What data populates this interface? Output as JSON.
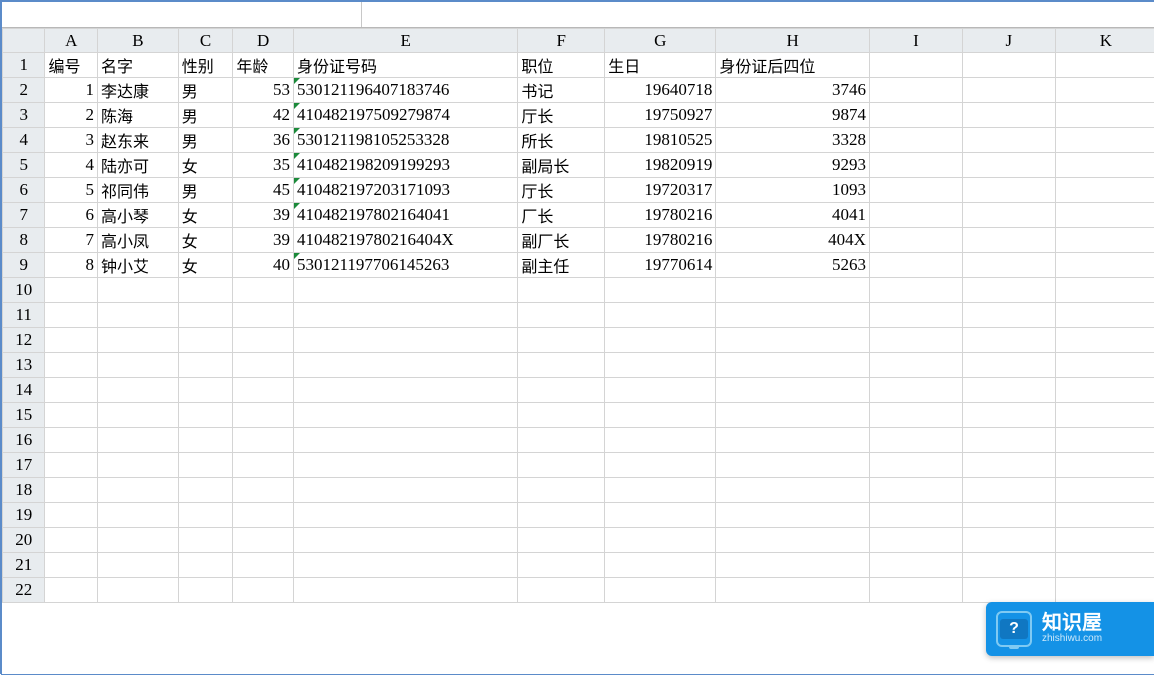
{
  "columns": [
    "A",
    "B",
    "C",
    "D",
    "E",
    "F",
    "G",
    "H",
    "I",
    "J",
    "K"
  ],
  "colClasses": [
    "cA",
    "cB",
    "cC",
    "cD",
    "cE",
    "cF",
    "cG",
    "cH",
    "cI",
    "cJ",
    "cK"
  ],
  "header_row": {
    "A": "编号",
    "B": "名字",
    "C": "性别",
    "D": "年龄",
    "E": "身份证号码",
    "F": "职位",
    "G": "生日",
    "H": "身份证后四位"
  },
  "rows": [
    {
      "no": "1",
      "name": "李达康",
      "sex": "男",
      "age": "53",
      "id": "530121196407183746",
      "title": "书记",
      "bday": "19640718",
      "last4": "3746"
    },
    {
      "no": "2",
      "name": "陈海",
      "sex": "男",
      "age": "42",
      "id": "410482197509279874",
      "title": "厅长",
      "bday": "19750927",
      "last4": "9874"
    },
    {
      "no": "3",
      "name": "赵东来",
      "sex": "男",
      "age": "36",
      "id": "530121198105253328",
      "title": "所长",
      "bday": "19810525",
      "last4": "3328"
    },
    {
      "no": "4",
      "name": "陆亦可",
      "sex": "女",
      "age": "35",
      "id": "410482198209199293",
      "title": "副局长",
      "bday": "19820919",
      "last4": "9293"
    },
    {
      "no": "5",
      "name": "祁同伟",
      "sex": "男",
      "age": "45",
      "id": "410482197203171093",
      "title": "厅长",
      "bday": "19720317",
      "last4": "1093"
    },
    {
      "no": "6",
      "name": "高小琴",
      "sex": "女",
      "age": "39",
      "id": "410482197802164041",
      "title": "厂长",
      "bday": "19780216",
      "last4": "4041"
    },
    {
      "no": "7",
      "name": "高小凤",
      "sex": "女",
      "age": "39",
      "id": "41048219780216404X",
      "title": "副厂长",
      "bday": "19780216",
      "last4": "404X"
    },
    {
      "no": "8",
      "name": "钟小艾",
      "sex": "女",
      "age": "40",
      "id": "530121197706145263",
      "title": "副主任",
      "bday": "19770614",
      "last4": "5263"
    }
  ],
  "emptyRowStart": 10,
  "emptyRowEnd": 22,
  "watermark": {
    "title": "知识屋",
    "sub": "zhishiwu.com",
    "iconGlyph": "?"
  }
}
